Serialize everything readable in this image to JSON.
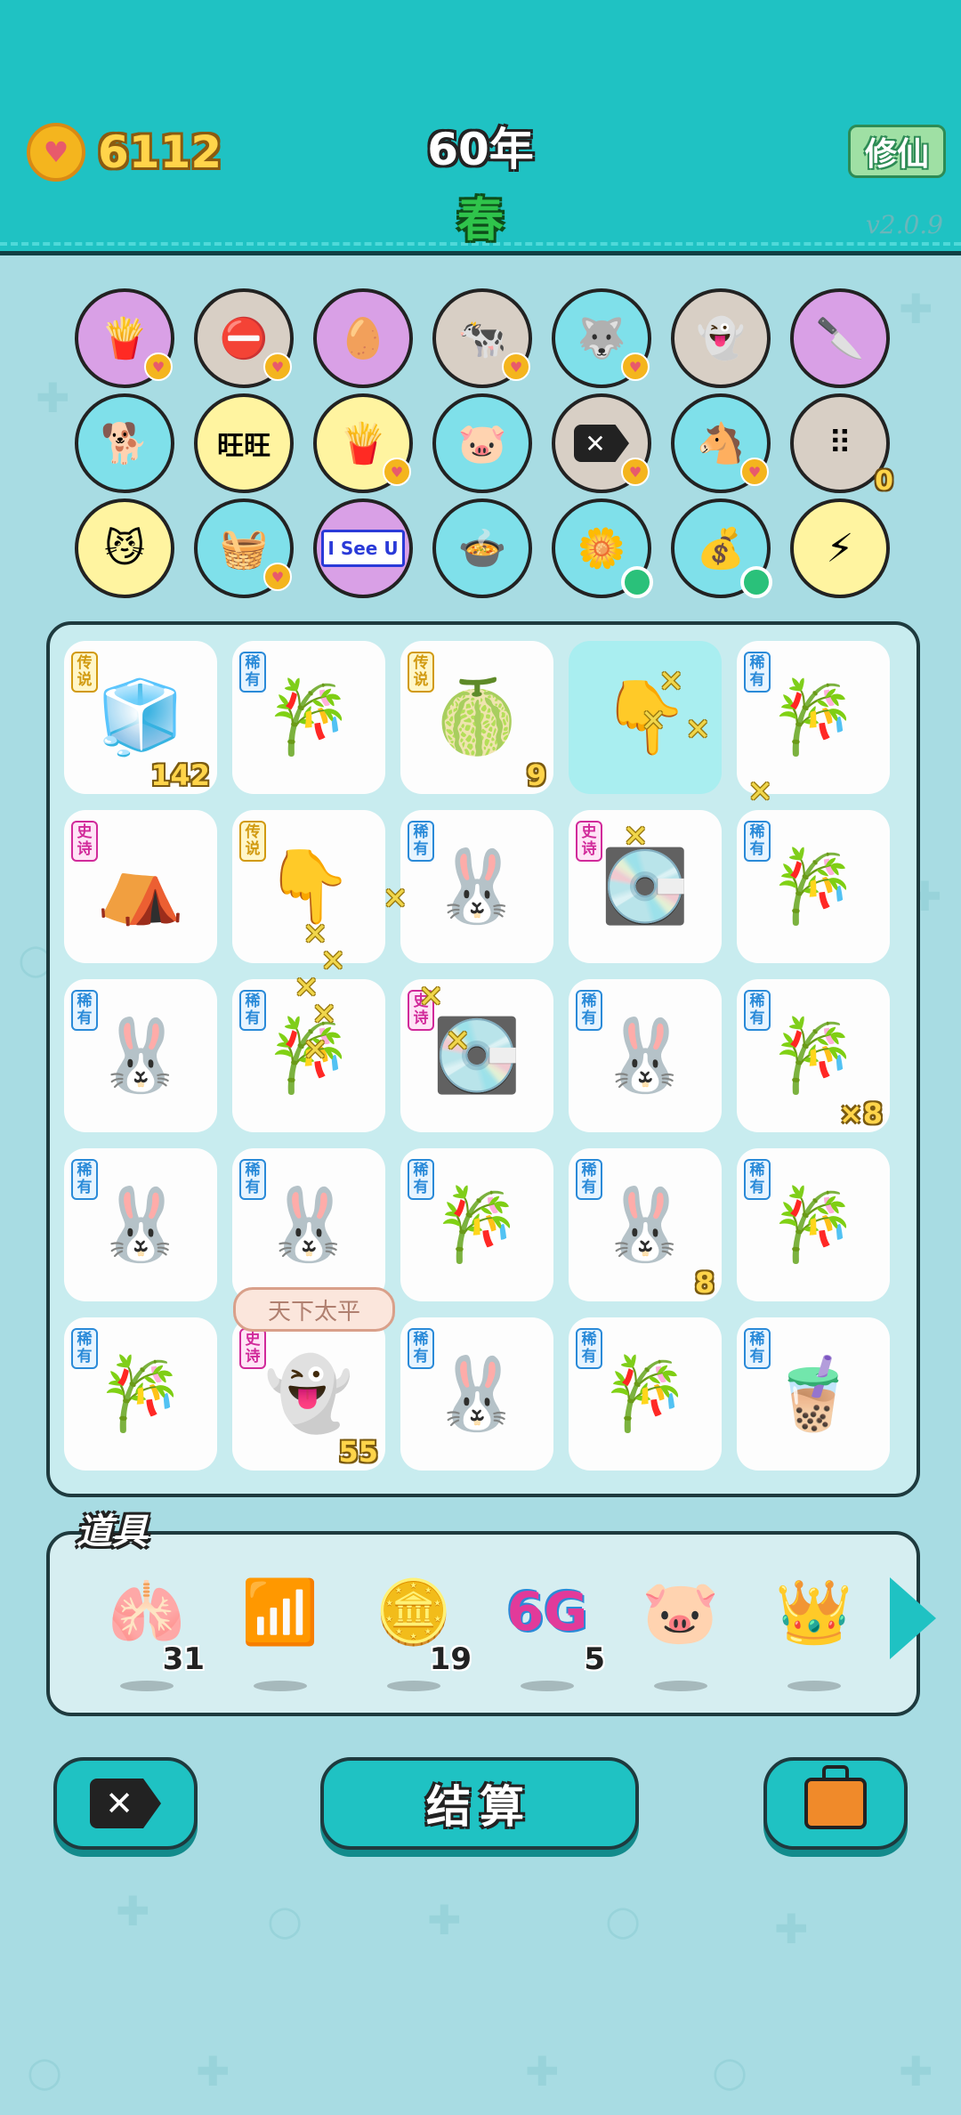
{
  "header": {
    "coins": "6112",
    "year": "60年",
    "season": "春",
    "cultivate_label": "修仙",
    "version": "v2.0.9"
  },
  "icons": {
    "row1": [
      "fries-icon",
      "no-entry-icon",
      "egg-icon",
      "cows-icon",
      "husky-icon",
      "ghost-icon",
      "cleaver-icon"
    ],
    "row2": [
      "doge-icon",
      "wang-icon",
      "fries-icon",
      "piggy-bank-icon",
      "delete-tag-icon",
      "cows-icon",
      "egg-tray-icon"
    ],
    "row3": [
      "sunglasses-cat-icon",
      "fruit-basket-icon",
      "i-see-u-icon",
      "duck-pot-icon",
      "flower-pot-icon",
      "money-bag-icon",
      "lightning-icon"
    ],
    "egg_tray_count": "0",
    "i_see_u_text": "I See U"
  },
  "board": {
    "tiles": [
      {
        "name": "fridge",
        "badge": "传说",
        "kind": "legend",
        "count": "142"
      },
      {
        "name": "bamboo",
        "badge": "稀有",
        "kind": "rare",
        "count": ""
      },
      {
        "name": "longan",
        "badge": "传说",
        "kind": "legend",
        "count": "9"
      },
      {
        "name": "pointing-hand",
        "badge": "",
        "kind": "",
        "count": ""
      },
      {
        "name": "bamboo",
        "badge": "稀有",
        "kind": "rare",
        "count": ""
      },
      {
        "name": "rabbit-house",
        "badge": "史诗",
        "kind": "epic",
        "count": ""
      },
      {
        "name": "pointing-hand",
        "badge": "传说",
        "kind": "legend",
        "count": ""
      },
      {
        "name": "rabbit",
        "badge": "稀有",
        "kind": "rare",
        "count": ""
      },
      {
        "name": "graphics-card",
        "badge": "史诗",
        "kind": "epic",
        "count": ""
      },
      {
        "name": "bamboo",
        "badge": "稀有",
        "kind": "rare",
        "count": ""
      },
      {
        "name": "rabbit",
        "badge": "稀有",
        "kind": "rare",
        "count": ""
      },
      {
        "name": "bamboo",
        "badge": "稀有",
        "kind": "rare",
        "count": ""
      },
      {
        "name": "graphics-card",
        "badge": "史诗",
        "kind": "epic",
        "count": ""
      },
      {
        "name": "rabbit",
        "badge": "稀有",
        "kind": "rare",
        "count": ""
      },
      {
        "name": "bamboo",
        "badge": "稀有",
        "kind": "rare",
        "count": "×8"
      },
      {
        "name": "rabbit",
        "badge": "稀有",
        "kind": "rare",
        "count": ""
      },
      {
        "name": "rabbit",
        "badge": "稀有",
        "kind": "rare",
        "count": ""
      },
      {
        "name": "bamboo",
        "badge": "稀有",
        "kind": "rare",
        "count": ""
      },
      {
        "name": "rabbit",
        "badge": "稀有",
        "kind": "rare",
        "count": "8"
      },
      {
        "name": "bamboo",
        "badge": "稀有",
        "kind": "rare",
        "count": ""
      },
      {
        "name": "bamboo",
        "badge": "稀有",
        "kind": "rare",
        "count": ""
      },
      {
        "name": "black-white-impermanence",
        "badge": "史诗",
        "kind": "epic",
        "count": "55"
      },
      {
        "name": "rabbit",
        "badge": "稀有",
        "kind": "rare",
        "count": ""
      },
      {
        "name": "bamboo",
        "badge": "稀有",
        "kind": "rare",
        "count": ""
      },
      {
        "name": "bubble-tea",
        "badge": "稀有",
        "kind": "rare",
        "count": ""
      }
    ],
    "peace_banner": "天下太平"
  },
  "items": {
    "label": "道具",
    "list": [
      {
        "name": "liver",
        "qty": "31"
      },
      {
        "name": "wifi-frame",
        "qty": ""
      },
      {
        "name": "dollar-coin",
        "qty": "19"
      },
      {
        "name": "6g",
        "qty": "5"
      },
      {
        "name": "piggy-bank",
        "qty": ""
      },
      {
        "name": "crown",
        "qty": ""
      }
    ],
    "six_g_text": "6G"
  },
  "buttons": {
    "settle_label": "结算"
  },
  "colors": {
    "header": "#1fc2c3",
    "background": "#a8dce3",
    "coin_text": "#ffd44a",
    "season_green": "#2fc44b"
  }
}
